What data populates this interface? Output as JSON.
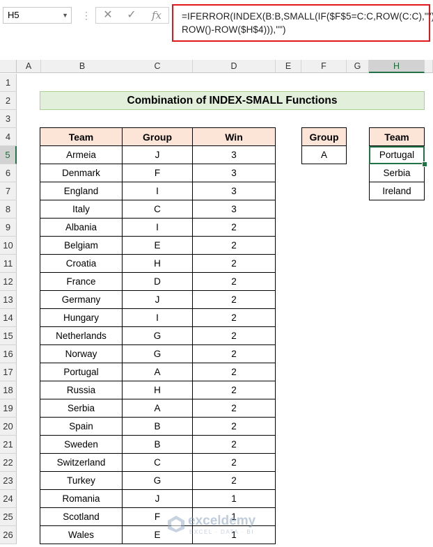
{
  "formula_bar": {
    "name_box": "H5",
    "cancel_icon": "✕",
    "enter_icon": "✓",
    "fx_icon": "fx",
    "formula_line1": "=IFERROR(INDEX(B:B,SMALL(IF($F$5=C:C,ROW(C:C),\"\"),",
    "formula_line2": "ROW()-ROW($H$4))),\"\")"
  },
  "columns": [
    "A",
    "B",
    "C",
    "D",
    "E",
    "F",
    "G",
    "H"
  ],
  "selected_column": "H",
  "rows": [
    "1",
    "2",
    "3",
    "4",
    "5",
    "6",
    "7",
    "8",
    "9",
    "10",
    "11",
    "12",
    "13",
    "14",
    "15",
    "16",
    "17",
    "18",
    "19",
    "20",
    "21",
    "22",
    "23",
    "24",
    "25",
    "26"
  ],
  "selected_row": "5",
  "title": "Combination of INDEX-SMALL Functions",
  "main_table": {
    "headers": [
      "Team",
      "Group",
      "Win"
    ],
    "rows": [
      [
        "Armeia",
        "J",
        "3"
      ],
      [
        "Denmark",
        "F",
        "3"
      ],
      [
        "England",
        "I",
        "3"
      ],
      [
        "Italy",
        "C",
        "3"
      ],
      [
        "Albania",
        "I",
        "2"
      ],
      [
        "Belgiam",
        "E",
        "2"
      ],
      [
        "Croatia",
        "H",
        "2"
      ],
      [
        "France",
        "D",
        "2"
      ],
      [
        "Germany",
        "J",
        "2"
      ],
      [
        "Hungary",
        "I",
        "2"
      ],
      [
        "Netherlands",
        "G",
        "2"
      ],
      [
        "Norway",
        "G",
        "2"
      ],
      [
        "Portugal",
        "A",
        "2"
      ],
      [
        "Russia",
        "H",
        "2"
      ],
      [
        "Serbia",
        "A",
        "2"
      ],
      [
        "Spain",
        "B",
        "2"
      ],
      [
        "Sweden",
        "B",
        "2"
      ],
      [
        "Switzerland",
        "C",
        "2"
      ],
      [
        "Turkey",
        "G",
        "2"
      ],
      [
        "Romania",
        "J",
        "1"
      ],
      [
        "Scotland",
        "F",
        "1"
      ],
      [
        "Wales",
        "E",
        "1"
      ]
    ]
  },
  "group_table": {
    "header": "Group",
    "value": "A"
  },
  "result_table": {
    "header": "Team",
    "values": [
      "Portugal",
      "Serbia",
      "Ireland"
    ]
  },
  "watermark": {
    "name": "exceldemy",
    "tagline": "EXCEL · DATA · BI"
  },
  "colors": {
    "title_fill": "#e2efda",
    "header_fill": "#fce4d6",
    "formula_border": "#e0181b",
    "selection": "#217346"
  }
}
